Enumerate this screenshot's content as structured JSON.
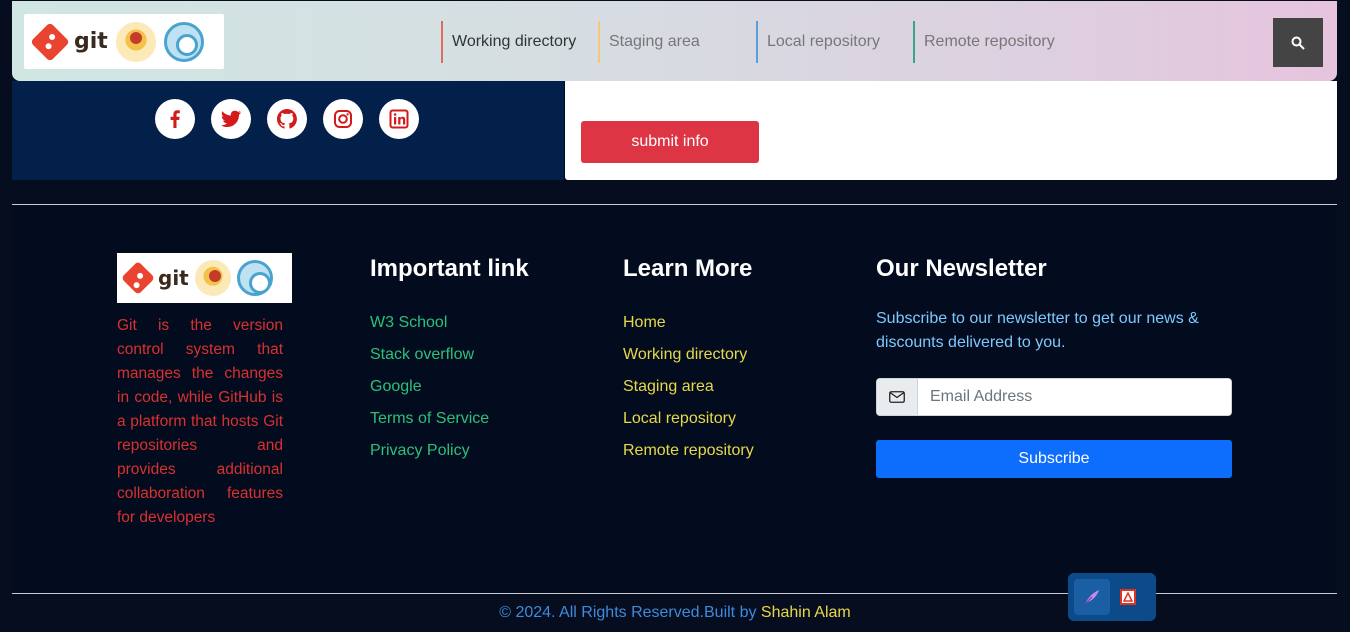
{
  "navbar": {
    "logo_text": "git",
    "links": [
      "Working directory",
      "Staging area",
      "Local repository",
      "Remote repository"
    ],
    "search_icon": "search-icon"
  },
  "contact": {
    "socials": [
      "facebook",
      "twitter",
      "github",
      "instagram",
      "linkedin"
    ],
    "submit_label": "submit info"
  },
  "footer": {
    "logo_text": "git",
    "about": "Git is the version control system that manages the changes in code, while GitHub is a platform that hosts Git repositories and provides additional collaboration features for developers",
    "important": {
      "title": "Important link",
      "links": [
        "W3 School",
        "Stack overflow",
        "Google",
        "Terms of Service",
        "Privacy Policy"
      ]
    },
    "learn": {
      "title": "Learn More",
      "links": [
        "Home",
        "Working directory",
        "Staging area",
        "Local repository",
        "Remote repository"
      ]
    },
    "newsletter": {
      "title": "Our Newsletter",
      "text": "Subscribe to our newsletter to get our news & discounts delivered to you.",
      "placeholder": "Email Address",
      "button": "Subscribe"
    },
    "copyright_prefix": "© 2024. All Rights Reserved.Built by ",
    "copyright_author": "Shahin Alam"
  },
  "colors": {
    "submit": "#de3545",
    "subscribe": "#0d6efd",
    "important_links": "#2cc07a",
    "learn_links": "#e7d84a",
    "about_text": "#d93030"
  }
}
